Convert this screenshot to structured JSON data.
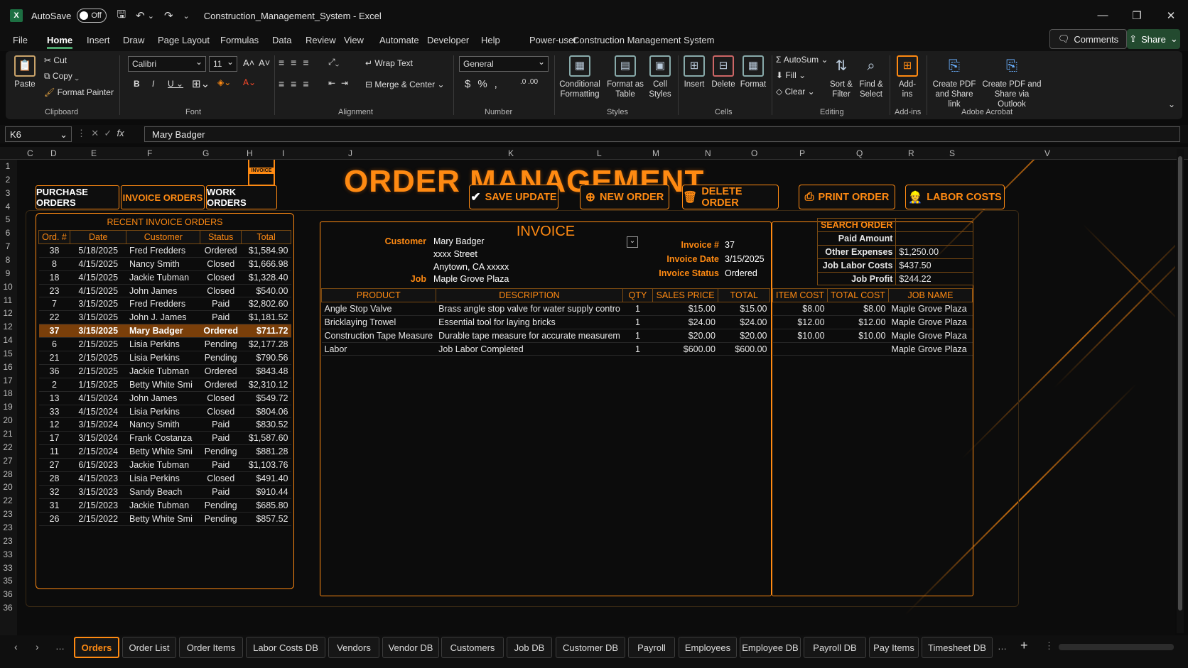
{
  "window": {
    "autosave_label": "AutoSave",
    "autosave_state": "Off",
    "title": "Construction_Management_System - Excel"
  },
  "menu": [
    "File",
    "Home",
    "Insert",
    "Draw",
    "Page Layout",
    "Formulas",
    "Data",
    "Review",
    "View",
    "Automate",
    "Developer",
    "Help",
    "Power-user",
    "Construction Management System"
  ],
  "comments_label": "Comments",
  "share_label": "Share",
  "ribbon": {
    "paste": "Paste",
    "cut": "Cut",
    "copy": "Copy",
    "format_painter": "Format Painter",
    "clipboard": "Clipboard",
    "font_name": "Calibri",
    "font_size": "11",
    "font": "Font",
    "wrap_text": "Wrap Text",
    "merge_center": "Merge & Center",
    "alignment": "Alignment",
    "number_format": "General",
    "number": "Number",
    "conditional": "Conditional",
    "formatting": "Formatting",
    "format_as": "Format as",
    "table": "Table",
    "cell": "Cell",
    "styles_btn": "Styles",
    "styles": "Styles",
    "insert": "Insert",
    "delete": "Delete",
    "format": "Format",
    "cells": "Cells",
    "autosum": "AutoSum",
    "fill": "Fill",
    "clear": "Clear",
    "sort": "Sort &",
    "filter": "Filter",
    "find": "Find &",
    "select": "Select",
    "editing": "Editing",
    "addins": "Add-ins",
    "addins_grp": "Add-ins",
    "create_pdf": "Create PDF",
    "share_link": "and Share link",
    "create_pdf2": "Create PDF and",
    "share_outlook": "Share via Outlook",
    "acrobat": "Adobe Acrobat"
  },
  "formula": {
    "cell_ref": "K6",
    "value": "Mary Badger"
  },
  "columns": [
    "C",
    "D",
    "E",
    "F",
    "G",
    "H",
    "I",
    "J",
    "K",
    "L",
    "M",
    "N",
    "O",
    "P",
    "Q",
    "R",
    "S",
    "V"
  ],
  "rows": [
    "1",
    "2",
    "3",
    "4",
    "5",
    "6",
    "7",
    "8",
    "9",
    "10",
    "11",
    "12",
    "12",
    "14",
    "15",
    "16",
    "17",
    "18",
    "19",
    "20",
    "21",
    "22",
    "27",
    "28",
    "20",
    "22",
    "23",
    "23",
    "23",
    "33",
    "33",
    "35",
    "36",
    "36"
  ],
  "header": {
    "title": "ORDER MANAGEMENT",
    "invoice_icon_text": "INVOICE"
  },
  "nav_tabs": [
    "PURCHASE ORDERS",
    "INVOICE ORDERS",
    "WORK ORDERS"
  ],
  "actions": [
    "SAVE UPDATE",
    "NEW ORDER",
    "DELETE ORDER",
    "PRINT ORDER",
    "LABOR COSTS"
  ],
  "recent": {
    "title": "RECENT INVOICE ORDERS",
    "columns": [
      "Ord. #",
      "Date",
      "Customer",
      "Status",
      "Total"
    ],
    "rows": [
      [
        "38",
        "5/18/2025",
        "Fred Fredders",
        "Ordered",
        "$1,584.90"
      ],
      [
        "8",
        "4/15/2025",
        "Nancy Smith",
        "Closed",
        "$1,666.98"
      ],
      [
        "18",
        "4/15/2025",
        "Jackie Tubman",
        "Closed",
        "$1,328.40"
      ],
      [
        "23",
        "4/15/2025",
        "John James",
        "Closed",
        "$540.00"
      ],
      [
        "7",
        "3/15/2025",
        "Fred Fredders",
        "Paid",
        "$2,802.60"
      ],
      [
        "22",
        "3/15/2025",
        "John J. James",
        "Paid",
        "$1,181.52"
      ],
      [
        "37",
        "3/15/2025",
        "Mary Badger",
        "Ordered",
        "$711.72"
      ],
      [
        "6",
        "2/15/2025",
        "Lisia Perkins",
        "Pending",
        "$2,177.28"
      ],
      [
        "21",
        "2/15/2025",
        "Lisia Perkins",
        "Pending",
        "$790.56"
      ],
      [
        "36",
        "2/15/2025",
        "Jackie Tubman",
        "Ordered",
        "$843.48"
      ],
      [
        "2",
        "1/15/2025",
        "Betty White Smi",
        "Ordered",
        "$2,310.12"
      ],
      [
        "13",
        "4/15/2024",
        "John James",
        "Closed",
        "$549.72"
      ],
      [
        "33",
        "4/15/2024",
        "Lisia Perkins",
        "Closed",
        "$804.06"
      ],
      [
        "12",
        "3/15/2024",
        "Nancy Smith",
        "Paid",
        "$830.52"
      ],
      [
        "17",
        "3/15/2024",
        "Frank Costanza",
        "Paid",
        "$1,587.60"
      ],
      [
        "11",
        "2/15/2024",
        "Betty White Smi",
        "Pending",
        "$881.28"
      ],
      [
        "27",
        "6/15/2023",
        "Jackie Tubman",
        "Paid",
        "$1,103.76"
      ],
      [
        "28",
        "4/15/2023",
        "Lisia Perkins",
        "Closed",
        "$491.40"
      ],
      [
        "32",
        "3/15/2023",
        "Sandy Beach",
        "Paid",
        "$910.44"
      ],
      [
        "31",
        "2/15/2023",
        "Jackie Tubman",
        "Pending",
        "$685.80"
      ],
      [
        "26",
        "2/15/2022",
        "Betty White Smi",
        "Pending",
        "$857.52"
      ]
    ],
    "highlight_index": 6
  },
  "invoice": {
    "title": "INVOICE",
    "customer_label": "Customer",
    "customer": "Mary Badger",
    "street": "xxxx Street",
    "city": "Anytown, CA xxxxx",
    "job_label": "Job",
    "job": "Maple Grove Plaza",
    "inv_no_label": "Invoice #",
    "inv_no": "37",
    "inv_date_label": "Invoice Date",
    "inv_date": "3/15/2025",
    "inv_status_label": "Invoice Status",
    "inv_status": "Ordered",
    "columns": [
      "PRODUCT",
      "DESCRIPTION",
      "QTY",
      "SALES PRICE",
      "TOTAL"
    ],
    "items": [
      [
        "Angle Stop Valve",
        "Brass angle stop valve for water supply contro",
        "1",
        "$15.00",
        "$15.00"
      ],
      [
        "Bricklaying Trowel",
        "Essential tool for laying bricks",
        "1",
        "$24.00",
        "$24.00"
      ],
      [
        "Construction Tape Measure",
        "Durable tape measure for accurate measurem",
        "1",
        "$20.00",
        "$20.00"
      ],
      [
        "Labor",
        "Job Labor Completed",
        "1",
        "$600.00",
        "$600.00"
      ]
    ]
  },
  "cost": {
    "columns": [
      "ITEM COST",
      "TOTAL COST",
      "JOB NAME"
    ],
    "rows": [
      [
        "$8.00",
        "$8.00",
        "Maple Grove Plaza"
      ],
      [
        "$12.00",
        "$12.00",
        "Maple Grove Plaza"
      ],
      [
        "$10.00",
        "$10.00",
        "Maple Grove Plaza"
      ],
      [
        "",
        "",
        "Maple Grove Plaza"
      ]
    ]
  },
  "summary": {
    "search_label": "SEARCH ORDER",
    "paid_label": "Paid Amount",
    "paid": "",
    "other_label": "Other Expenses",
    "other": "$1,250.00",
    "labor_label": "Job Labor Costs",
    "labor": "$437.50",
    "profit_label": "Job Profit",
    "profit": "$244.22"
  },
  "sheet_tabs": [
    "Orders",
    "Order List",
    "Order Items",
    "Labor Costs DB",
    "Vendors",
    "Vendor DB",
    "Customers",
    "Job DB",
    "Customer DB",
    "Payroll",
    "Employees",
    "Employee DB",
    "Payroll DB",
    "Pay Items",
    "Timesheet DB"
  ],
  "accent": "#ff8a12"
}
